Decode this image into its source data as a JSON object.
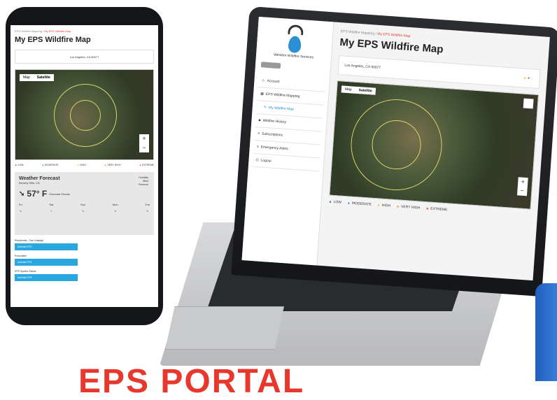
{
  "laptop": {
    "logo_text": "Western Wildfire Services",
    "breadcrumb_root": "EPS Wildfire Mapping /",
    "breadcrumb_current": "My EPS Wildfire Map",
    "title": "My EPS Wildfire Map",
    "location": "Los Angeles, CA 90077",
    "nav": [
      {
        "label": "Account"
      },
      {
        "label": "EPS Wildfire Mapping"
      },
      {
        "label": "My Wildfire Map"
      },
      {
        "label": "Wildfire History"
      },
      {
        "label": "Subscriptions"
      },
      {
        "label": "Emergency Alerts"
      },
      {
        "label": "Logout"
      }
    ],
    "map_tabs": [
      "Map",
      "Satellite"
    ],
    "legend": [
      "LOW",
      "MODERATE",
      "HIGH",
      "VERY HIGH",
      "EXTREME"
    ]
  },
  "phone": {
    "breadcrumb_root": "EPS Wildfire Mapping /",
    "breadcrumb_current": "My EPS Wildfire Map",
    "title": "My EPS Wildfire Map",
    "location": "Los Angeles, CA 90077",
    "map_tabs": [
      "Map",
      "Satellite"
    ],
    "legend": [
      "LOW",
      "MODERATE",
      "HIGH",
      "VERY HIGH",
      "EXTREME"
    ],
    "weather_title": "Weather Forecast",
    "weather_location": "Beverly Hills, CA",
    "temperature": "57° F",
    "temp_desc": "Overcast Clouds",
    "days": [
      "Fri",
      "Sat",
      "Sun",
      "Mon",
      "Tue"
    ],
    "side_info": [
      "Humidity",
      "Wind",
      "Pressure"
    ],
    "fields": [
      {
        "label": "Residential - Gas Leakage",
        "button": "Activate EPS"
      },
      {
        "label": "Evacuation",
        "button": "Activate EPS"
      },
      {
        "label": "EPS System Status",
        "button": "Activate EPS"
      }
    ]
  },
  "banner": "EPS PORTAL"
}
